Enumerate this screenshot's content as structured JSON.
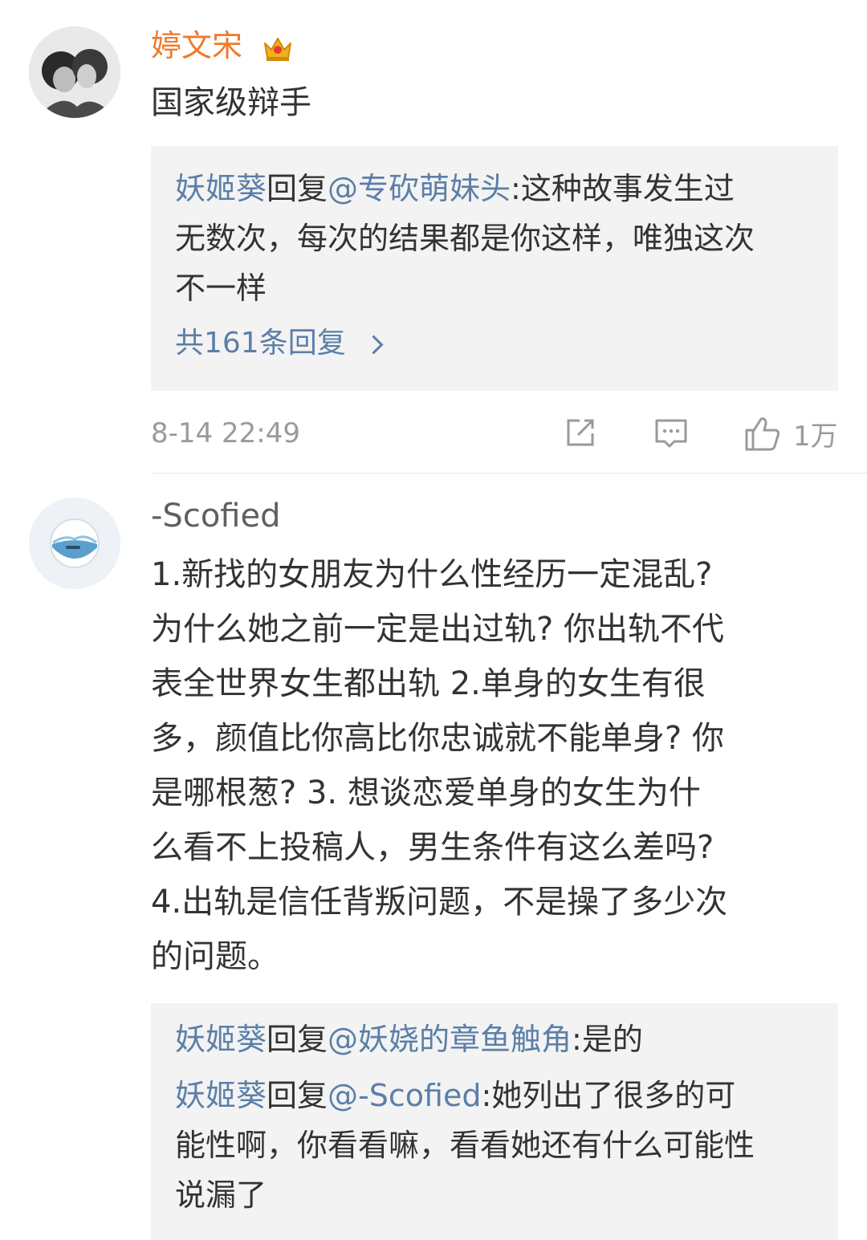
{
  "comments": [
    {
      "username": "婷文宋",
      "text": "国家级辩手",
      "replies": [
        {
          "author": "妖姬葵",
          "verb": "回复",
          "mention": "@专砍萌妹头",
          "content_lines": [
            ":这种故事发生过",
            "无数次，每次的结果都是你这样，唯独这次",
            "不一样"
          ]
        }
      ],
      "more_replies": "共161条回复",
      "timestamp": "8-14 22:49",
      "like_count": "1万"
    },
    {
      "username": "-Scofied",
      "text_lines": [
        "1.新找的女朋友为什么性经历一定混乱?",
        "为什么她之前一定是出过轨? 你出轨不代",
        "表全世界女生都出轨 2.单身的女生有很",
        "多，颜值比你高比你忠诚就不能单身? 你",
        "是哪根葱? 3. 想谈恋爱单身的女生为什",
        "么看不上投稿人，男生条件有这么差吗?",
        "4.出轨是信任背叛问题，不是操了多少次",
        "的问题。"
      ],
      "replies": [
        {
          "author": "妖姬葵",
          "verb": "回复",
          "mention": "@妖娆的章鱼触角",
          "content_lines": [
            ":是的"
          ]
        },
        {
          "author": "妖姬葵",
          "verb": "回复",
          "mention": "@-Scofied",
          "content_lines": [
            ":她列出了很多的可",
            "能性啊，你看看嘛，看看她还有什么可能性",
            "说漏了"
          ]
        }
      ]
    }
  ],
  "icons": {
    "vip_badge": "crown-icon",
    "share": "share-icon",
    "comment": "comment-icon",
    "like": "thumbs-up-icon"
  },
  "colors": {
    "username_orange": "#f07a2a",
    "link_blue": "#5b7fa8",
    "meta_gray": "#9a9a9a",
    "reply_bg": "#f3f3f3"
  }
}
